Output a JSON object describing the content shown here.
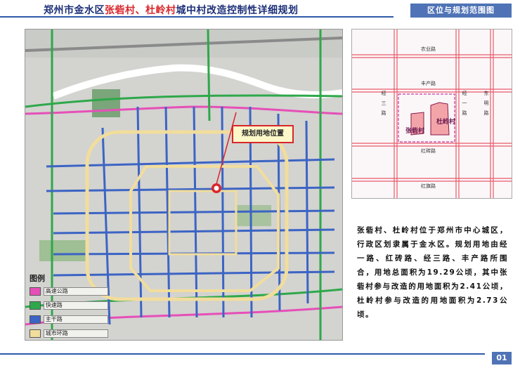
{
  "header": {
    "title_prefix": "郑州市金水区",
    "title_village1": "张砦村",
    "title_sep": "、",
    "title_village2": "杜岭村",
    "title_suffix": "城中村改造控制性详细规划",
    "section_tab": "区位与规划范围图"
  },
  "main_map": {
    "callout_label": "规划用地位置",
    "legend": {
      "title": "图例",
      "items": [
        {
          "label": "高速公路",
          "color": "#e64fb8"
        },
        {
          "label": "快速路",
          "color": "#2ea84a"
        },
        {
          "label": "主干路",
          "color": "#3c64c4"
        },
        {
          "label": "城市环路",
          "color": "#f1dd9c"
        }
      ]
    },
    "colors": {
      "expressway": "#e64fb8",
      "fast_road": "#2ea84a",
      "trunk_road": "#3c64c4",
      "ring_road": "#f1dd9c",
      "river": "#ffffff",
      "marker": "#d8262a"
    }
  },
  "inset": {
    "roads": {
      "north": "农业路",
      "middle": "丰产路",
      "lower": "红砖路",
      "bottom": "红旗路",
      "west": "经三路",
      "east1": "经一路",
      "east2": "东明路"
    },
    "parcels": {
      "zhangzhai": "张砦村",
      "duling": "杜岭村"
    }
  },
  "description": "张砦村、杜岭村位于郑州市中心城区，行政区划隶属于金水区。规划用地由经一路、红砖路、经三路、丰产路所围合，用地总面积为19.29公顷，其中张砦村参与改造的用地面积为2.41公顷，杜岭村参与改造的用地面积为2.73公顷。",
  "page_number": "01"
}
